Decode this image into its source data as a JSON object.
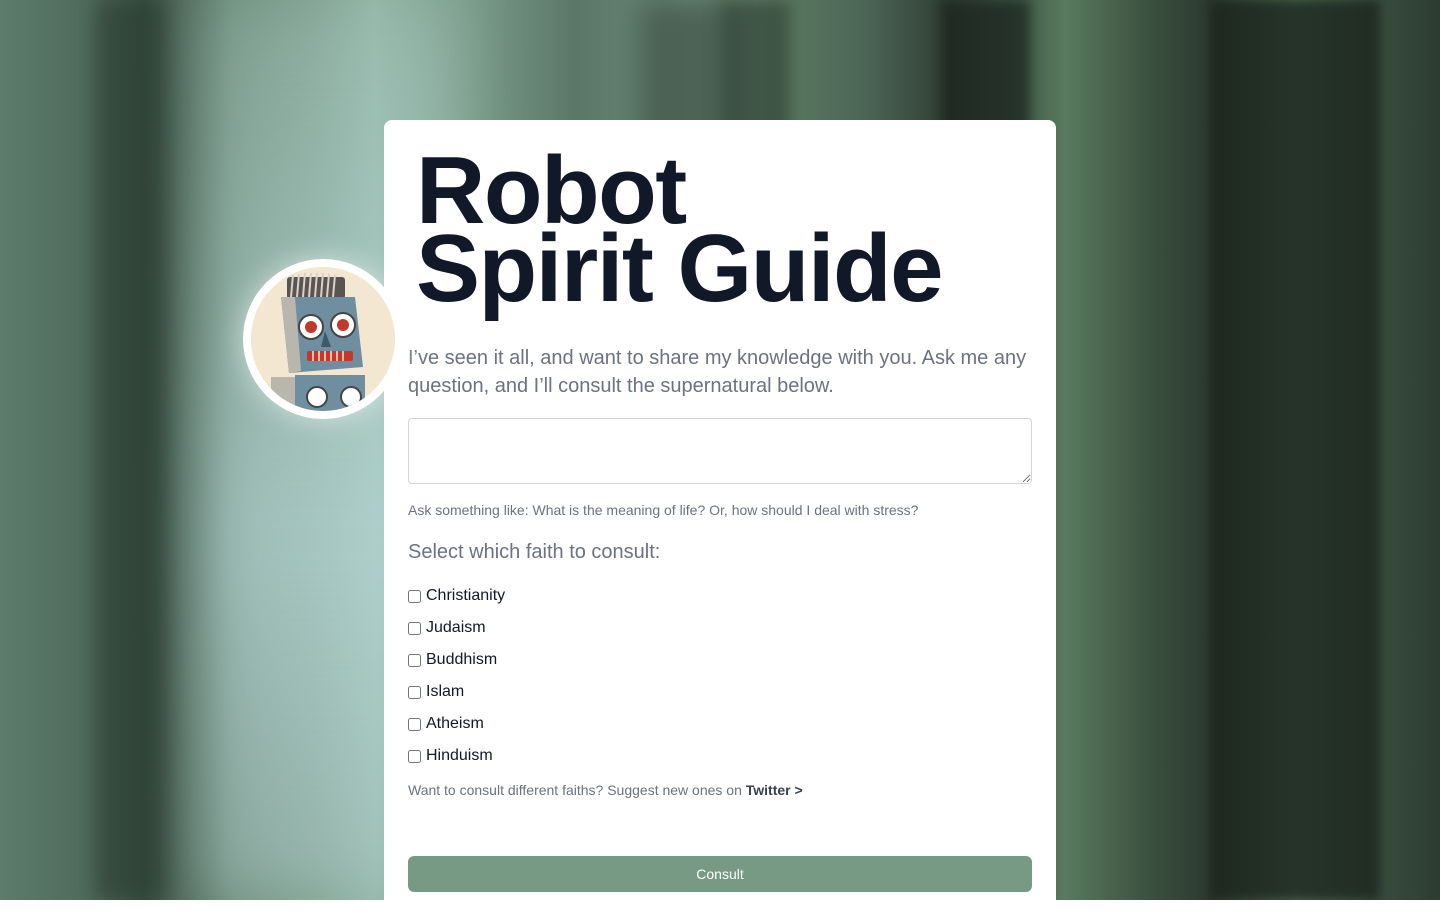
{
  "title": {
    "line1": "Robot",
    "line2": "Spirit Guide"
  },
  "intro": "I’ve seen it all, and want to share my knowledge with you. Ask me any question, and I’ll consult the supernatural below.",
  "question": {
    "value": "",
    "placeholder": ""
  },
  "hint": "Ask something like: What is the meaning of life? Or, how should I deal with stress?",
  "faith_prompt": "Select which faith to consult:",
  "faiths": [
    {
      "label": "Christianity",
      "checked": false
    },
    {
      "label": "Judaism",
      "checked": false
    },
    {
      "label": "Buddhism",
      "checked": false
    },
    {
      "label": "Islam",
      "checked": false
    },
    {
      "label": "Atheism",
      "checked": false
    },
    {
      "label": "Hinduism",
      "checked": false
    }
  ],
  "suggest": {
    "text": "Want to consult different faiths? Suggest new ones on ",
    "link_label": "Twitter >"
  },
  "consult_label": "Consult",
  "colors": {
    "button": "#769a83",
    "title": "#111827",
    "muted": "#6b7280"
  },
  "icons": {
    "avatar": "robot-avatar-icon"
  }
}
